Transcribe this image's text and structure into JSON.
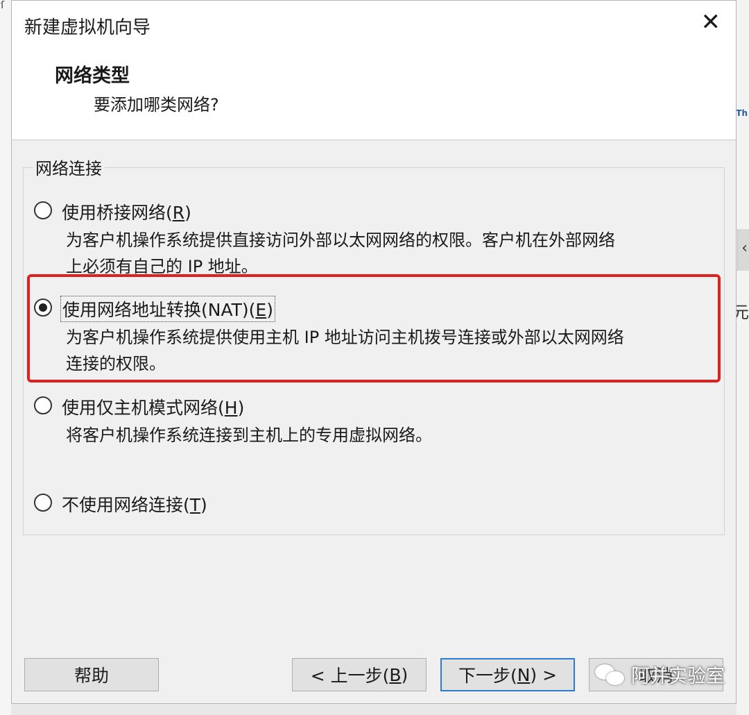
{
  "dialog": {
    "title": "新建虚拟机向导",
    "close_glyph": "✕",
    "page_title": "网络类型",
    "page_subtitle": "要添加哪类网络?"
  },
  "group": {
    "label": "网络连接"
  },
  "options": [
    {
      "label": "使用桥接网络(R)",
      "description_lines": [
        "为客户机操作系统提供直接访问外部以太网网络的权限。客户机在外部网络",
        "上必须有自己的 IP 地址。"
      ],
      "checked": false
    },
    {
      "label": "使用网络地址转换(NAT)(E)",
      "description_lines": [
        "为客户机操作系统提供使用主机 IP 地址访问主机拨号连接或外部以太网网络",
        "连接的权限。"
      ],
      "checked": true
    },
    {
      "label": "使用仅主机模式网络(H)",
      "description_lines": [
        "将客户机操作系统连接到主机上的专用虚拟网络。"
      ],
      "checked": false
    },
    {
      "label": "不使用网络连接(T)",
      "description_lines": [],
      "checked": false
    }
  ],
  "buttons": {
    "help": "帮助",
    "back": "< 上一步(B)",
    "next": "下一步(N) >",
    "cancel": "取消"
  },
  "watermark": {
    "text": "阿并实验室"
  },
  "colors": {
    "highlight_border": "#e02020",
    "default_button_border": "#2b7bd0"
  }
}
